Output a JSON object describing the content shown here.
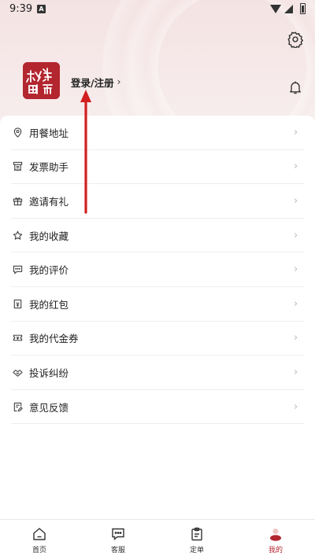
{
  "status_bar": {
    "time": "9:39",
    "notification": "A"
  },
  "header": {
    "avatar_logo_text": "私厨 炎席",
    "login_label": "登录/注册",
    "login_chevron": "›"
  },
  "menu": {
    "items": [
      {
        "label": "用餐地址",
        "icon": "location-pin-icon"
      },
      {
        "label": "发票助手",
        "icon": "invoice-icon"
      },
      {
        "label": "邀请有礼",
        "icon": "gift-icon"
      },
      {
        "label": "我的收藏",
        "icon": "star-icon"
      },
      {
        "label": "我的评价",
        "icon": "comment-icon"
      },
      {
        "label": "我的红包",
        "icon": "red-packet-icon"
      },
      {
        "label": "我的代金券",
        "icon": "voucher-icon"
      },
      {
        "label": "投诉纠纷",
        "icon": "handshake-icon"
      },
      {
        "label": "意见反馈",
        "icon": "feedback-icon"
      }
    ],
    "chevron": "›"
  },
  "bottom_nav": {
    "items": [
      {
        "label": "首页",
        "icon": "home-icon"
      },
      {
        "label": "客服",
        "icon": "chat-icon"
      },
      {
        "label": "定单",
        "icon": "order-icon"
      },
      {
        "label": "我的",
        "icon": "profile-icon",
        "active": true
      }
    ]
  },
  "colors": {
    "brand": "#b3262f",
    "annotation": "#d11f1f"
  }
}
